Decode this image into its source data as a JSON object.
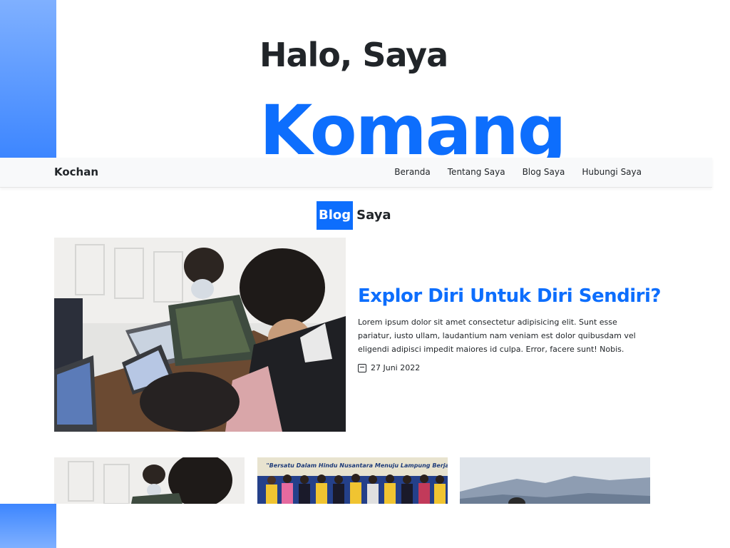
{
  "hero": {
    "greeting": "Halo, Saya",
    "name": "Komang"
  },
  "navbar": {
    "brand": "Kochan",
    "links": [
      "Beranda",
      "Tentang Saya",
      "Blog Saya",
      "Hubungi Saya"
    ]
  },
  "blog": {
    "title_highlight": "Blog",
    "title_rest": "Saya",
    "featured": {
      "title": "Explor Diri Untuk Diri Sendiri?",
      "excerpt": "Lorem ipsum dolor sit amet consectetur adipisicing elit. Sunt esse pariatur, iusto ullam, laudantium nam veniam est dolor quibusdam vel eligendi adipisci impedit maiores id culpa. Error, facere sunt! Nobis.",
      "date": "27 Juni 2022",
      "date_icon": "calendar-icon"
    },
    "thumbnails": [
      {
        "banner": ""
      },
      {
        "banner": "\"Bersatu Dalam Hindu Nusantara Menuju Lampung Berjaya\""
      },
      {
        "banner": ""
      }
    ]
  },
  "colors": {
    "accent": "#0d6efd",
    "navbar_bg": "#f8f9fa",
    "text": "#212529",
    "deco": "#3d86ff"
  }
}
